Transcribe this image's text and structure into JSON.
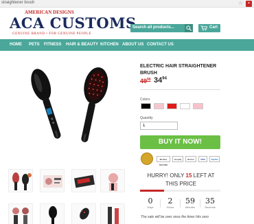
{
  "browser": {
    "address": "straightener brush"
  },
  "logo": {
    "top": "AMERICAN DESIGNS",
    "main": "ACA CUSTOMS",
    "sub": "GENUINE BRAND • FOR GENUINE PEOPLE"
  },
  "header": {
    "search_placeholder": "Search all products...",
    "cart_label": "Cart"
  },
  "nav": {
    "items": [
      "HOME",
      "PETS",
      "FITNESS",
      "HAIR & BEAUTY",
      "KITCHEN",
      "ABOUT US",
      "CONTACT US"
    ]
  },
  "product": {
    "title": "ELECTRIC HAIR STRAIGHTENER BRUSH",
    "price_old": "49",
    "price_old_cents": "99",
    "price_new": "34",
    "price_new_cents": "94",
    "colors_label": "Colors",
    "colors": [
      "#000000",
      "#f6c6cf",
      "#e01b1b",
      "#ffffff",
      "#f8c2cc"
    ],
    "quantity_label": "Quantity",
    "quantity_value": "1",
    "buy_label": "BUY IT NOW!"
  },
  "trust_badges": [
    "McAfee SECURE",
    "shopify",
    "Norton",
    "VISA",
    "PayPal"
  ],
  "urgency": {
    "prefix": "HURRY! ONLY",
    "count": "15",
    "suffix": "LEFT AT THIS PRICE",
    "stock_fraction": 0.3
  },
  "timer": [
    {
      "value": "0",
      "unit": "Days"
    },
    {
      "value": "2",
      "unit": "Hours"
    },
    {
      "value": "59",
      "unit": "Minutes"
    },
    {
      "value": "35",
      "unit": "Seconds"
    }
  ],
  "sale_note": "The sale will be over once the timer hits zero",
  "colors": {
    "accent": "#4aa79a",
    "buy": "#6bbf45",
    "price": "#c62828"
  }
}
